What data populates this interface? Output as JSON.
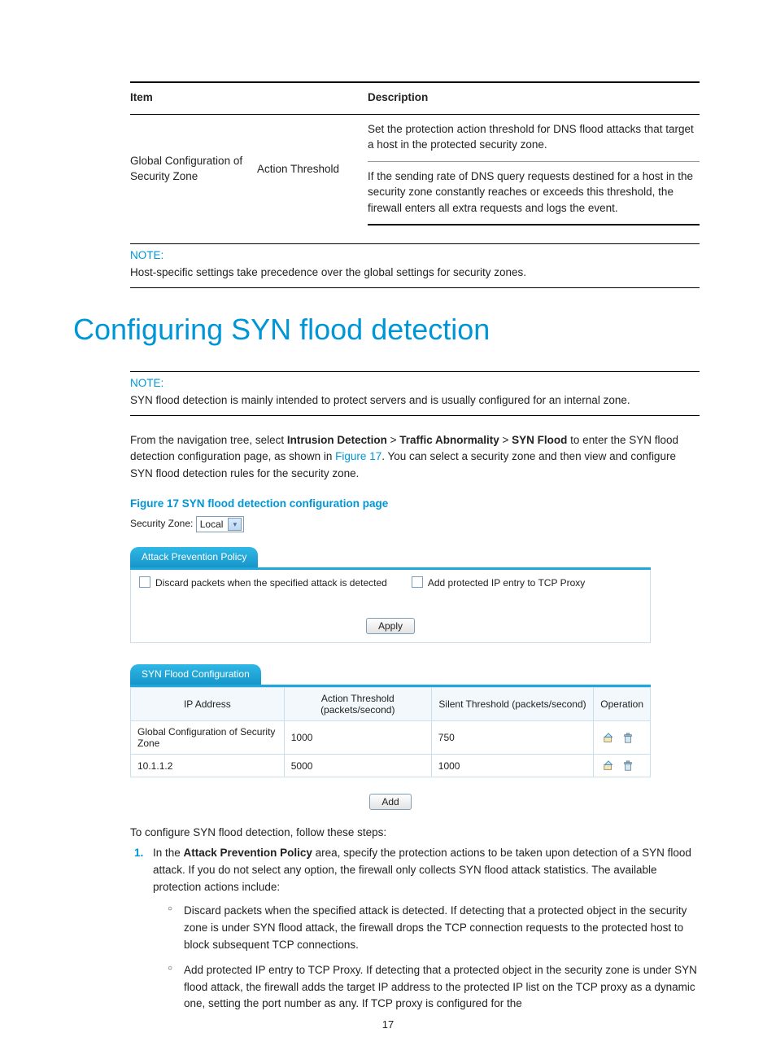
{
  "def_table": {
    "headers": [
      "Item",
      "Description"
    ],
    "item": "Global Configuration of Security Zone",
    "sub": "Action Threshold",
    "desc1": "Set the protection action threshold for DNS flood attacks that target a host in the protected security zone.",
    "desc2": "If the sending rate of DNS query requests destined for a host in the security zone constantly reaches or exceeds this threshold, the firewall enters all extra requests and logs the event."
  },
  "note1": {
    "label": "NOTE:",
    "text": "Host-specific settings take precedence over the global settings for security zones."
  },
  "heading": "Configuring SYN flood detection",
  "note2": {
    "label": "NOTE:",
    "text": "SYN flood detection is mainly intended to protect servers and is usually configured for an internal zone."
  },
  "para1": {
    "pre": "From the navigation tree, select ",
    "b1": "Intrusion Detection",
    "sep": " > ",
    "b2": "Traffic Abnormality",
    "b3": "SYN Flood",
    "mid": " to enter the SYN flood detection configuration page, as shown in ",
    "link": "Figure 17",
    "post": ". You can select a security zone and then view and configure SYN flood detection rules for the security zone."
  },
  "fig_caption": "Figure 17 SYN flood detection configuration page",
  "screenshot": {
    "sz_label": "Security Zone:",
    "sz_value": "Local",
    "tab1": "Attack Prevention Policy",
    "chk1": "Discard packets when the specified attack is detected",
    "chk2": "Add protected IP entry to TCP Proxy",
    "apply": "Apply",
    "tab2": "SYN Flood Configuration",
    "cfg_headers": [
      "IP Address",
      "Action Threshold (packets/second)",
      "Silent Threshold (packets/second)",
      "Operation"
    ],
    "rows": [
      {
        "ip": "Global Configuration of Security Zone",
        "action": "1000",
        "silent": "750"
      },
      {
        "ip": "10.1.1.2",
        "action": "5000",
        "silent": "1000"
      }
    ],
    "add": "Add"
  },
  "steps_intro": "To configure SYN flood detection, follow these steps:",
  "step1": {
    "pre": "In the ",
    "b": "Attack Prevention Policy",
    "post": " area, specify the protection actions to be taken upon detection of a SYN flood attack. If you do not select any option, the firewall only collects SYN flood attack statistics. The available protection actions include:",
    "sub1": "Discard packets when the specified attack is detected. If detecting that a protected object in the security zone is under SYN flood attack, the firewall drops the TCP connection requests to the protected host to block subsequent TCP connections.",
    "sub2": "Add protected IP entry to TCP Proxy. If detecting that a protected object in the security zone is under SYN flood attack, the firewall adds the target IP address to the protected IP list on the TCP proxy as a dynamic one, setting the port number as any. If TCP proxy is configured for the"
  },
  "page_number": "17",
  "chart_data": {
    "type": "table",
    "title": "SYN Flood Configuration",
    "columns": [
      "IP Address",
      "Action Threshold (packets/second)",
      "Silent Threshold (packets/second)"
    ],
    "rows": [
      [
        "Global Configuration of Security Zone",
        1000,
        750
      ],
      [
        "10.1.1.2",
        5000,
        1000
      ]
    ]
  }
}
